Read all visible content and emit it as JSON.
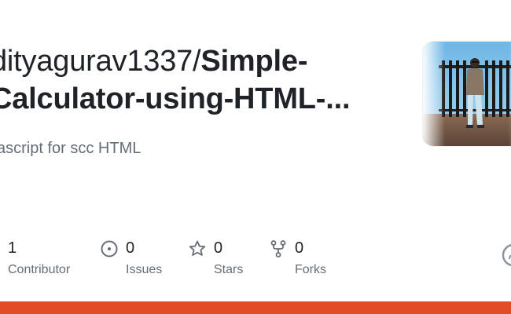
{
  "repo": {
    "owner_part": "dityagurav1337/",
    "name_part1": "Simple-",
    "name_part2": "Calculator-using-HTML-...",
    "description": "vascript for scc HTML"
  },
  "stats": [
    {
      "icon": "people-icon",
      "value": "1",
      "label": "Contributor"
    },
    {
      "icon": "issues-icon",
      "value": "0",
      "label": "Issues"
    },
    {
      "icon": "star-icon",
      "value": "0",
      "label": "Stars"
    },
    {
      "icon": "fork-icon",
      "value": "0",
      "label": "Forks"
    }
  ],
  "colors": {
    "accent_bar": "#e34c26",
    "title_text": "#1f2328",
    "muted_text": "#656d76"
  }
}
